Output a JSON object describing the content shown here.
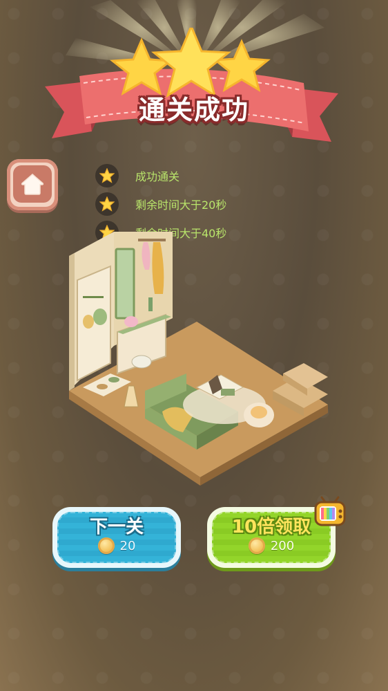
{
  "header": {
    "title": "通关成功",
    "stars_earned": 3
  },
  "home": {
    "icon": "home-icon"
  },
  "criteria": [
    {
      "text": "成功通关",
      "icon": "star-icon"
    },
    {
      "text": "剩余时间大于20秒",
      "icon": "star-icon"
    },
    {
      "text": "剩余时间大于40秒",
      "icon": "star-icon"
    }
  ],
  "buttons": {
    "next": {
      "label": "下一关",
      "reward": "20",
      "icon": "coin-icon"
    },
    "ten_times": {
      "label": "10倍领取",
      "reward": "200",
      "icon": "coin-icon",
      "badge_icon": "tv-ad-icon"
    }
  },
  "colors": {
    "criteria_text": "#b9e56b",
    "next_button": "#34b3d8",
    "ten_button": "#93d52a",
    "ribbon": "#e8686a"
  }
}
